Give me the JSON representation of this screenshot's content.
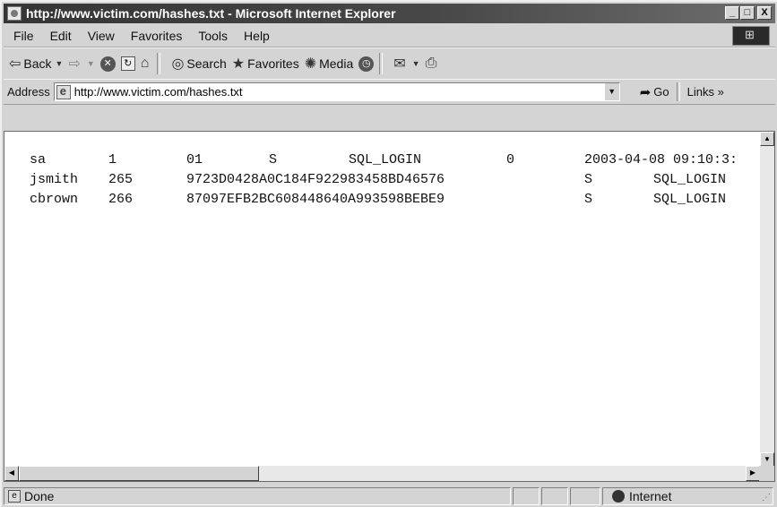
{
  "window": {
    "title": "http://www.victim.com/hashes.txt - Microsoft Internet Explorer",
    "minimize": "_",
    "maximize": "□",
    "close": "X"
  },
  "menu": [
    "File",
    "Edit",
    "View",
    "Favorites",
    "Tools",
    "Help"
  ],
  "toolbar": {
    "back": "Back",
    "search": "Search",
    "favorites": "Favorites",
    "media": "Media"
  },
  "address": {
    "label": "Address",
    "url": "http://www.victim.com/hashes.txt",
    "go": "Go",
    "links": "Links »"
  },
  "content": {
    "rows": [
      [
        "sa",
        "1",
        "01",
        "S",
        "SQL_LOGIN",
        "0",
        "2003-04-08 09:10:3:"
      ],
      [
        "jsmith",
        "265",
        "9723D0428A0C184F922983458BD46576",
        "",
        "S",
        "",
        "SQL_LOGIN"
      ],
      [
        "cbrown",
        "266",
        "87097EFB2BC608448640A993598BEBE9",
        "",
        "S",
        "",
        "SQL_LOGIN"
      ]
    ]
  },
  "status": {
    "text": "Done",
    "zone": "Internet"
  },
  "icons": {
    "app": "ie-icon",
    "back": "back-arrow-icon",
    "forward": "forward-arrow-icon",
    "stop": "stop-icon",
    "refresh": "refresh-icon",
    "home": "home-icon",
    "search": "search-icon",
    "favorites": "favorites-icon",
    "media": "media-icon",
    "history": "history-icon",
    "mail": "mail-icon",
    "print": "print-icon"
  }
}
